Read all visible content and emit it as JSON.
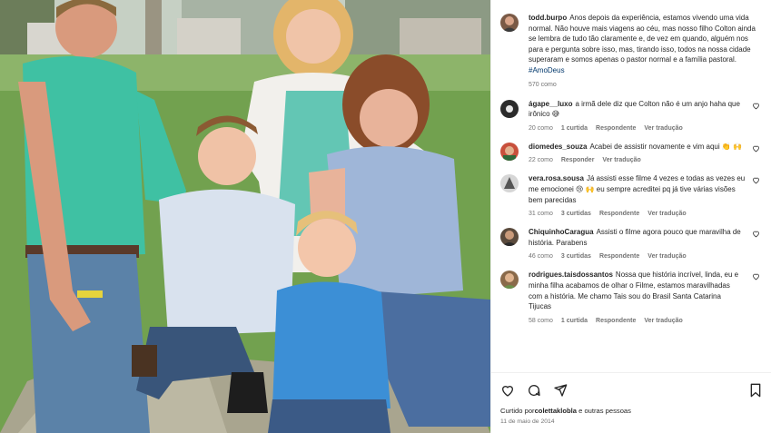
{
  "post": {
    "author": "todd.burpo",
    "caption": "Anos depois da experiência, estamos vivendo uma vida normal. Não houve mais viagens ao céu, mas nosso filho Colton ainda se lembra de tudo tão claramente e, de vez em quando, alguém nos para e pergunta sobre isso, mas, tirando isso, todos na nossa cidade superaram e somos apenas o pastor normal e a família pastoral.",
    "hashtag": "#AmoDeus",
    "likes": "570 como"
  },
  "comments": [
    {
      "user": "ágape__luxo",
      "text": "a irmã dele diz que Colton não é um anjo haha que irônico 😅",
      "likes": "20 como",
      "replies": "1 curtida",
      "reply": "Respondente",
      "translate": "Ver tradução",
      "avatar_color": "#2b2b2b"
    },
    {
      "user": "diomedes_souza",
      "text": "Acabei de assistir novamente e vim aqui 👏",
      "emoji2": "🙌",
      "likes": "22 como",
      "replies": "",
      "reply": "Responder",
      "translate": "Ver tradução",
      "avatar_color": "#c8503c"
    },
    {
      "user": "vera.rosa.sousa",
      "text": "Já assisti esse filme 4 vezes e todas as vezes eu me emocionei 😢 🙌 eu sempre acreditei pq já tive várias visões bem parecidas",
      "likes": "31 como",
      "replies": "3 curtidas",
      "reply": "Respondente",
      "translate": "Ver tradução",
      "avatar_color": "#7a7f86"
    },
    {
      "user": "ChiquinhoCaragua",
      "text": "Assisti o filme agora pouco que maravilha de história. Parabens",
      "likes": "46 como",
      "replies": "3 curtidas",
      "reply": "Respondente",
      "translate": "Ver tradução",
      "avatar_color": "#5a4a3c"
    },
    {
      "user": "rodrigues.taisdossantos",
      "text": "Nossa que história incrível, linda, eu e minha filha acabamos de olhar o Filme, estamos maravilhadas com a história. Me chamo Tais sou do Brasil Santa Catarina Tijucas",
      "likes": "58 como",
      "replies": "1 curtida",
      "reply": "Respondente",
      "translate": "Ver tradução",
      "avatar_color": "#8a6a4a"
    }
  ],
  "footer": {
    "liked_prefix": "Curtido por",
    "liked_user": "colettaklobla",
    "liked_suffix": " e outras pessoas",
    "date": "11 de maio de 2014"
  },
  "icons": {
    "like": "heart-icon",
    "comment": "comment-icon",
    "share": "share-icon",
    "save": "bookmark-icon"
  },
  "colors": {
    "hashtag": "#00376b",
    "muted": "#737373",
    "text": "#262626"
  }
}
